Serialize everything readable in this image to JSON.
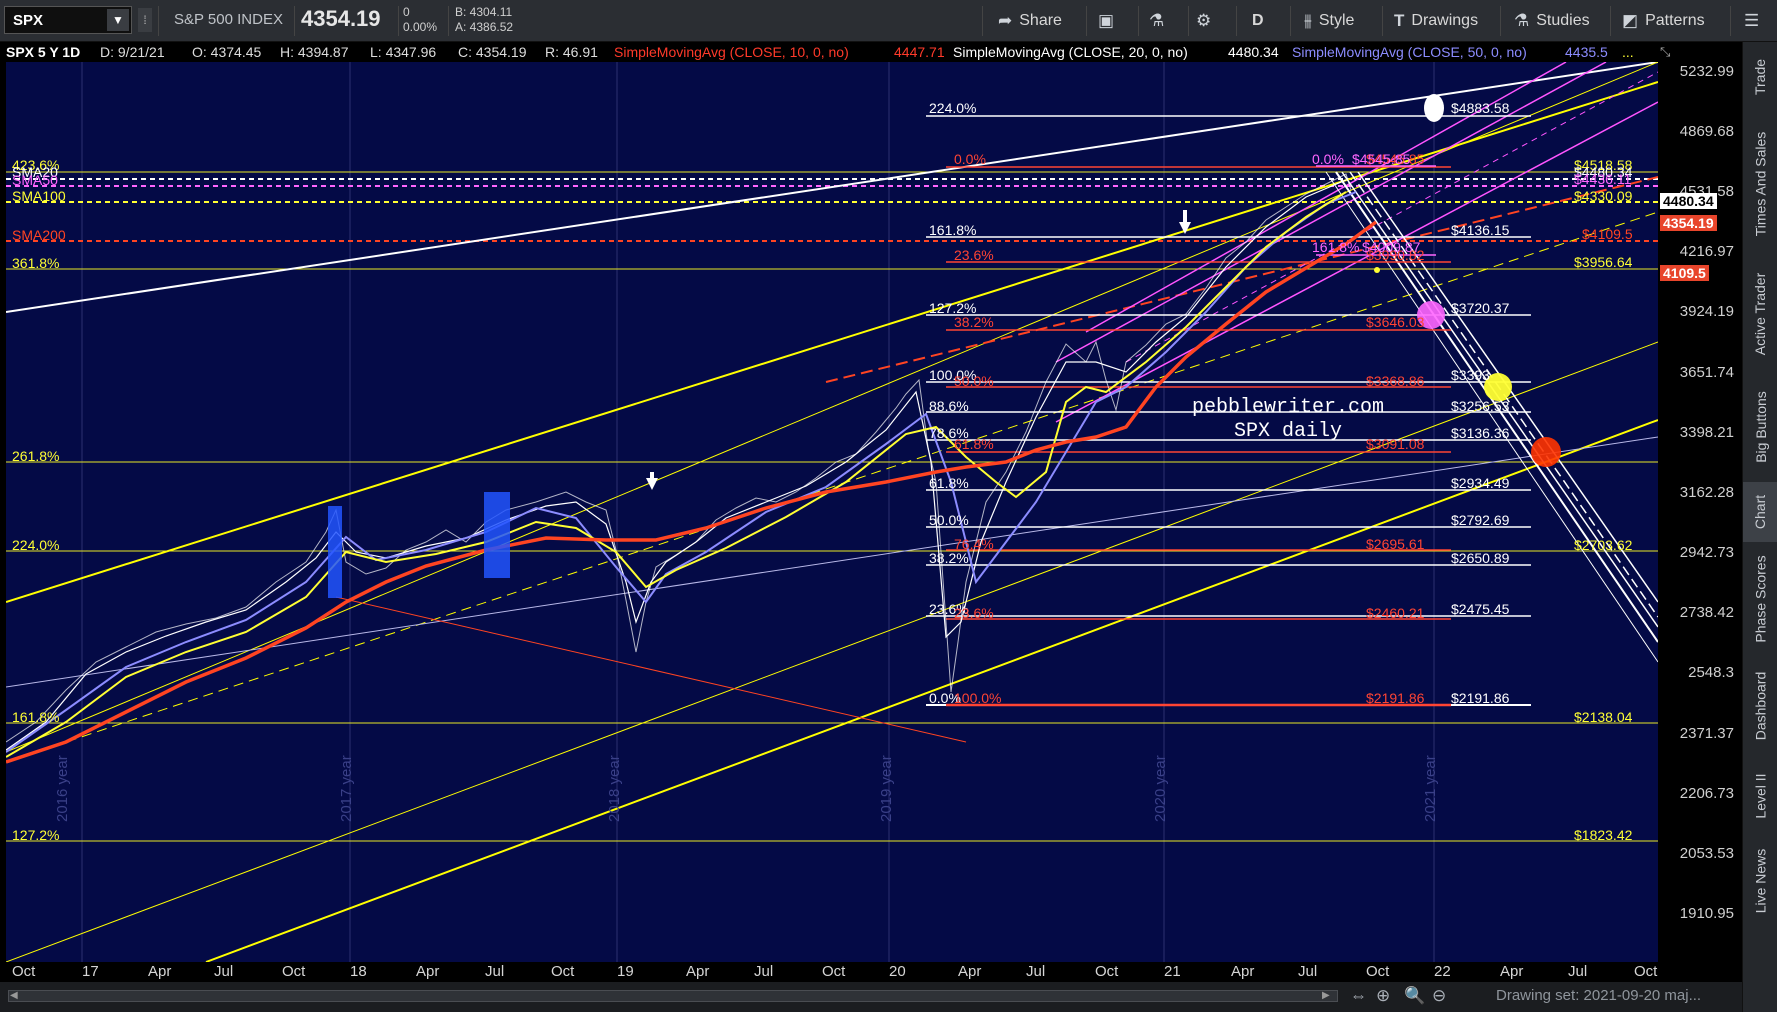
{
  "toolbar": {
    "symbol": "SPX",
    "name": "S&P 500 INDEX",
    "price": "4354.19",
    "change": "0",
    "change_pct": "0.00%",
    "bid": "B: 4304.11",
    "ask": "A: 4386.52",
    "share_label": "Share",
    "period_label": "D",
    "style_label": "Style",
    "drawings_label": "Drawings",
    "studies_label": "Studies",
    "patterns_label": "Patterns"
  },
  "infobar": {
    "header": "SPX 5 Y 1D",
    "date": "D: 9/21/21",
    "open": "O: 4374.45",
    "high": "H: 4394.87",
    "low": "L: 4347.96",
    "close": "C: 4354.19",
    "range": "R: 46.91",
    "sma10_label": "SimpleMovingAvg (CLOSE, 10, 0, no)",
    "sma10_value": "4447.71",
    "sma20_label": "SimpleMovingAvg (CLOSE, 20, 0, no)",
    "sma20_value": "4480.34",
    "sma50_label": "SimpleMovingAvg (CLOSE, 50, 0, no)",
    "sma50_value": "4435.5",
    "more": "..."
  },
  "price_axis": {
    "ticks": [
      "5232.99",
      "4869.68",
      "4531.58",
      "4216.97",
      "3924.19",
      "3651.74",
      "3398.21",
      "3162.28",
      "2942.73",
      "2738.42",
      "2548.3",
      "2371.37",
      "2206.73",
      "2053.53",
      "1910.95"
    ],
    "tags": [
      {
        "text": "4480.34",
        "color": "#000000",
        "bg": "#ffffff"
      },
      {
        "text": "4354.19",
        "color": "#ffffff",
        "bg": "#e8452b"
      },
      {
        "text": "4109.5",
        "color": "#ffffff",
        "bg": "#e8452b"
      }
    ]
  },
  "time_axis": {
    "labels": [
      "Oct",
      "17",
      "Apr",
      "Jul",
      "Oct",
      "18",
      "Apr",
      "Jul",
      "Oct",
      "19",
      "Apr",
      "Jul",
      "Oct",
      "20",
      "Apr",
      "Jul",
      "Oct",
      "21",
      "Apr",
      "Jul",
      "Oct",
      "22",
      "Apr",
      "Jul",
      "Oct"
    ]
  },
  "year_labels": [
    "2016 year",
    "2017 year",
    "2018 year",
    "2019 year",
    "2020 year",
    "2021 year"
  ],
  "left_labels": {
    "sma20": "SMA20",
    "sma50": "SMA50",
    "sma100": "SMA100",
    "sma200": "SMA200",
    "fib423": "423.6%",
    "fib361": "361.8%",
    "fib261": "261.8%",
    "fib224": "224.0%",
    "fib161": "161.8%",
    "fib127": "127.2%"
  },
  "fib_white": {
    "levels": [
      "224.0%",
      "161.8%",
      "127.2%",
      "100.0%",
      "88.6%",
      "78.6%",
      "61.8%",
      "50.0%",
      "38.2%",
      "23.6%",
      "0.0%"
    ],
    "prices": [
      "$4883.58",
      "$4136.15",
      "$3720.37",
      "$3393",
      "$3256.53",
      "$3136.36",
      "$2934.49",
      "$2792.69",
      "$2650.89",
      "$2475.45",
      "$2191.86"
    ]
  },
  "fib_red": {
    "levels": [
      "0.0%",
      "23.6%",
      "38.2%",
      "50.0%",
      "61.8%",
      "76.4%",
      "23.6%",
      "100.0%"
    ],
    "prices": [
      "$4545.85",
      "$3990.82",
      "$3646.03",
      "$3368.86",
      "$3091.08",
      "$2695.61",
      "$2460.21",
      "$2191.86"
    ]
  },
  "fib_pink": {
    "upper": "0.0%",
    "upper_price": "$4545.85",
    "lower": "161.8%",
    "lower_price": "$4009.87"
  },
  "right_yellow_labels": [
    "$4518.58",
    "$4480.34",
    "$4436.11",
    "$4330.09",
    "$3956.64",
    "$2703.62",
    "$2138.04",
    "$1823.42"
  ],
  "right_red_labels": [
    "$4109.5"
  ],
  "watermark": {
    "line1": "pebblewriter.com",
    "line2": "SPX daily"
  },
  "rail": [
    "Trade",
    "Times And Sales",
    "Active Trader",
    "Big Buttons",
    "Chart",
    "Phase Scores",
    "Dashboard",
    "Level II",
    "Live News"
  ],
  "bottom": {
    "drawing_set": "Drawing set: 2021-09-20 maj..."
  },
  "colors": {
    "chart_bg": "#040a46",
    "sma10": "#ffffff",
    "sma20": "#ffff33",
    "sma50": "#8c8cff",
    "sma200": "#ff4422",
    "fib_red": "#ff4433",
    "channel_yellow": "#ffff00",
    "channel_pink": "#ff55ff"
  }
}
